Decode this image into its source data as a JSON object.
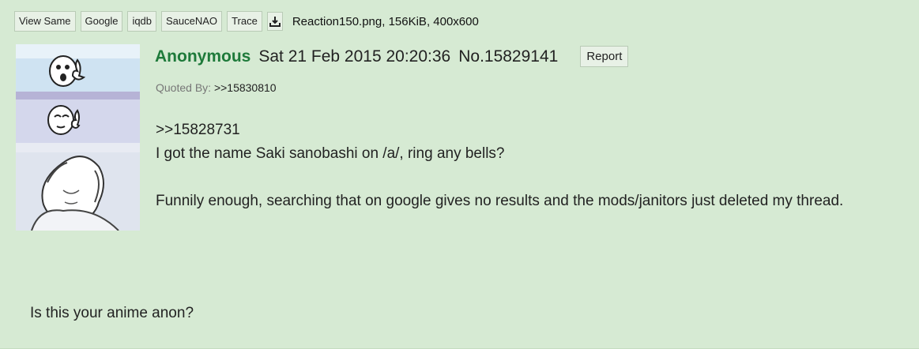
{
  "toolbar": {
    "buttons": [
      "View Same",
      "Google",
      "iqdb",
      "SauceNAO",
      "Trace"
    ],
    "download_icon": "download-icon",
    "file_info": "Reaction150.png, 156KiB, 400x600"
  },
  "post": {
    "name": "Anonymous",
    "datetime": "Sat 21 Feb 2015 20:20:36",
    "post_number": "No.15829141",
    "report_label": "Report",
    "quoted_by_label": "Quoted By:",
    "quoted_by_link": ">>15830810",
    "quote_link": ">>15828731",
    "line1": "I got the name Saki sanobashi on /a/, ring any bells?",
    "line2": "Funnily enough, searching that on google gives no results and the mods/janitors just deleted my thread."
  },
  "trailing_text": "Is this your anime anon?",
  "colors": {
    "background": "#d6ead3",
    "name_green": "#1e7a3a",
    "button_bg": "#e8f1e6"
  }
}
